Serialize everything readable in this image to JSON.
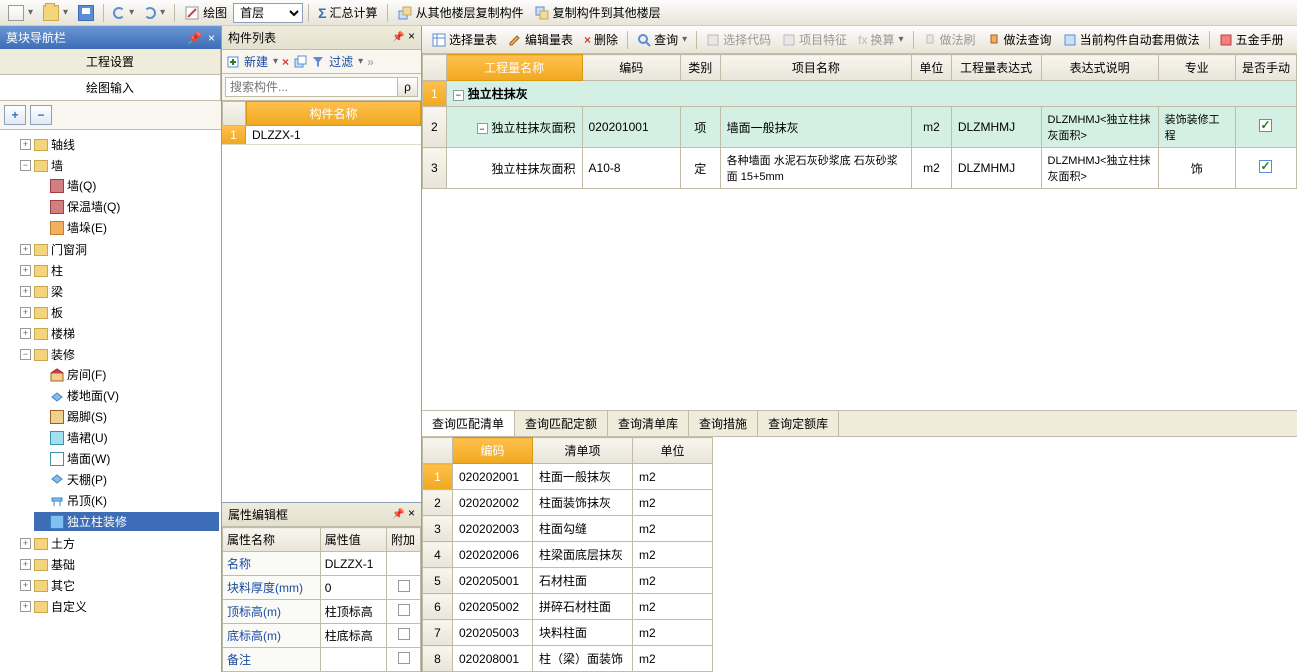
{
  "topToolbar": {
    "draw": "绘图",
    "floorLabel": "首层",
    "sigma": "Σ",
    "sumCalc": "汇总计算",
    "copyFromOther": "从其他楼层复制构件",
    "copyToOther": "复制构件到其他楼层"
  },
  "nav": {
    "title": "莫块导航栏",
    "pin": "📌",
    "close": "×",
    "tabs": {
      "setup": "工程设置",
      "draw": "绘图输入"
    },
    "plus": "+",
    "minus": "−",
    "tree": {
      "axis": "轴线",
      "wall": "墙",
      "wall_q": "墙(Q)",
      "wall_bw": "保温墙(Q)",
      "wall_d": "墙垛(E)",
      "opening": "门窗洞",
      "column": "柱",
      "beam": "梁",
      "slab": "板",
      "stair": "楼梯",
      "decor": "装修",
      "room": "房间(F)",
      "floor": "楼地面(V)",
      "skirt": "踢脚(S)",
      "wainscot": "墙裙(U)",
      "wallface": "墙面(W)",
      "ceiling": "天棚(P)",
      "hang": "吊顶(K)",
      "colDecor": "独立柱装修",
      "earth": "土方",
      "found": "基础",
      "other": "其它",
      "custom": "自定义"
    }
  },
  "compPanel": {
    "title": "构件列表",
    "new": "新建",
    "filter": "过滤",
    "searchPlaceholder": "搜索构件...",
    "header": "构件名称",
    "rows": [
      {
        "n": "1",
        "name": "DLZZX-1"
      }
    ]
  },
  "propPanel": {
    "title": "属性编辑框",
    "cols": {
      "name": "属性名称",
      "val": "属性值",
      "add": "附加"
    },
    "rows": [
      {
        "k": "名称",
        "v": "DLZZX-1"
      },
      {
        "k": "块料厚度(mm)",
        "v": "0"
      },
      {
        "k": "顶标高(m)",
        "v": "柱顶标高"
      },
      {
        "k": "底标高(m)",
        "v": "柱底标高"
      },
      {
        "k": "备注",
        "v": ""
      }
    ]
  },
  "mainToolbar": {
    "selectTable": "选择量表",
    "editTable": "编辑量表",
    "delete": "删除",
    "query": "查询",
    "selectCode": "选择代码",
    "projFeature": "项目特征",
    "convert": "换算",
    "brush": "做法刷",
    "brushQuery": "做法查询",
    "autoApply": "当前构件自动套用做法",
    "hardware": "五金手册"
  },
  "mainGrid": {
    "cols": {
      "name": "工程量名称",
      "code": "编码",
      "type": "类别",
      "proj": "项目名称",
      "unit": "单位",
      "expr": "工程量表达式",
      "desc": "表达式说明",
      "spec": "专业",
      "manual": "是否手动"
    },
    "rows": [
      {
        "rn": "1",
        "lvl": 0,
        "exp": "−",
        "name": "独立柱抹灰",
        "code": "",
        "type": "",
        "proj": "",
        "unit": "",
        "expr": "",
        "desc": "",
        "spec": "",
        "chk": ""
      },
      {
        "rn": "2",
        "lvl": 1,
        "exp": "−",
        "name": "独立柱抹灰面积",
        "code": "020201001",
        "type": "项",
        "proj": "墙面一般抹灰",
        "unit": "m2",
        "expr": "DLZMHMJ",
        "desc": "DLZMHMJ<独立柱抹灰面积>",
        "spec": "装饰装修工程",
        "chk": true
      },
      {
        "rn": "3",
        "lvl": 2,
        "exp": "",
        "name": "独立柱抹灰面积",
        "code": "A10-8",
        "type": "定",
        "proj": "各种墙面 水泥石灰砂浆底 石灰砂浆面 15+5mm",
        "unit": "m2",
        "expr": "DLZMHMJ",
        "desc": "DLZMHMJ<独立柱抹灰面积>",
        "spec": "饰",
        "chk": true
      }
    ]
  },
  "bottomTabs": {
    "t1": "查询匹配清单",
    "t2": "查询匹配定额",
    "t3": "查询清单库",
    "t4": "查询措施",
    "t5": "查询定额库"
  },
  "resultGrid": {
    "cols": {
      "code": "编码",
      "item": "清单项",
      "unit": "单位"
    },
    "rows": [
      {
        "n": "1",
        "code": "020202001",
        "item": "柱面一般抹灰",
        "unit": "m2"
      },
      {
        "n": "2",
        "code": "020202002",
        "item": "柱面装饰抹灰",
        "unit": "m2"
      },
      {
        "n": "3",
        "code": "020202003",
        "item": "柱面勾缝",
        "unit": "m2"
      },
      {
        "n": "4",
        "code": "020202006",
        "item": "柱梁面底层抹灰",
        "unit": "m2"
      },
      {
        "n": "5",
        "code": "020205001",
        "item": "石材柱面",
        "unit": "m2"
      },
      {
        "n": "6",
        "code": "020205002",
        "item": "拼碎石材柱面",
        "unit": "m2"
      },
      {
        "n": "7",
        "code": "020205003",
        "item": "块料柱面",
        "unit": "m2"
      },
      {
        "n": "8",
        "code": "020208001",
        "item": "柱（梁）面装饰",
        "unit": "m2"
      }
    ]
  }
}
